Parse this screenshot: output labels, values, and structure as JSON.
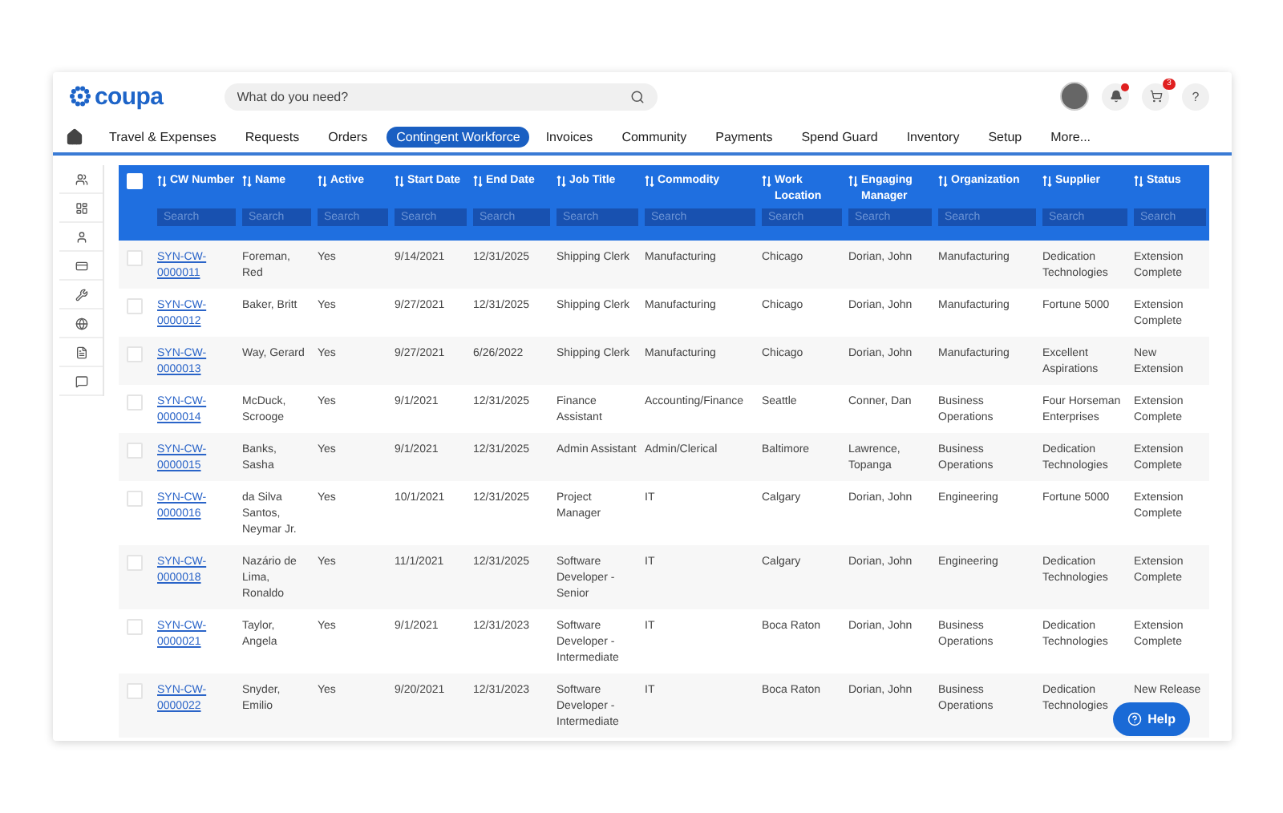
{
  "header": {
    "logo": "coupa",
    "search": {
      "placeholder": "What do you need?"
    },
    "notifications": {
      "unread": true
    },
    "cart": {
      "count": "3"
    },
    "help": "?"
  },
  "nav": [
    {
      "label": "Travel & Expenses",
      "selected": false
    },
    {
      "label": "Requests",
      "selected": false
    },
    {
      "label": "Orders",
      "selected": false
    },
    {
      "label": "Contingent Workforce",
      "selected": true
    },
    {
      "label": "Invoices",
      "selected": false
    },
    {
      "label": "Community",
      "selected": false
    },
    {
      "label": "Payments",
      "selected": false
    },
    {
      "label": "Spend Guard",
      "selected": false
    },
    {
      "label": "Inventory",
      "selected": false
    },
    {
      "label": "Setup",
      "selected": false
    },
    {
      "label": "More...",
      "selected": false
    }
  ],
  "sidebar": [
    {
      "kind": "people"
    },
    {
      "kind": "dashboard"
    },
    {
      "kind": "person"
    },
    {
      "kind": "card"
    },
    {
      "kind": "wrench"
    },
    {
      "kind": "globe"
    },
    {
      "kind": "document"
    },
    {
      "kind": "chat"
    }
  ],
  "table": {
    "select_all": {
      "checked": false
    },
    "columns": [
      {
        "label": "CW Number",
        "placeholder": "Search"
      },
      {
        "label": "Name",
        "placeholder": "Search"
      },
      {
        "label": "Active",
        "placeholder": "Search"
      },
      {
        "label": "Start Date",
        "placeholder": "Search"
      },
      {
        "label": "End Date",
        "placeholder": "Search"
      },
      {
        "label": "Job Title",
        "placeholder": "Search"
      },
      {
        "label": "Commodity",
        "placeholder": "Search"
      },
      {
        "label": "Work Location",
        "placeholder": "Search"
      },
      {
        "label": "Engaging Manager",
        "placeholder": "Search"
      },
      {
        "label": "Organization",
        "placeholder": "Search"
      },
      {
        "label": "Supplier",
        "placeholder": "Search"
      },
      {
        "label": "Status",
        "placeholder": "Search"
      }
    ],
    "rows": [
      {
        "checked": false,
        "cells": [
          "SYN-CW-0000011",
          "Foreman, Red",
          "Yes",
          "9/14/2021",
          "12/31/2025",
          "Shipping Clerk",
          "Manufacturing",
          "Chicago",
          "Dorian, John",
          "Manufacturing",
          "Dedication Technologies",
          "Extension Complete"
        ]
      },
      {
        "checked": false,
        "cells": [
          "SYN-CW-0000012",
          "Baker, Britt",
          "Yes",
          "9/27/2021",
          "12/31/2025",
          "Shipping Clerk",
          "Manufacturing",
          "Chicago",
          "Dorian, John",
          "Manufacturing",
          "Fortune 5000",
          "Extension Complete"
        ]
      },
      {
        "checked": false,
        "cells": [
          "SYN-CW-0000013",
          "Way, Gerard",
          "Yes",
          "9/27/2021",
          "6/26/2022",
          "Shipping Clerk",
          "Manufacturing",
          "Chicago",
          "Dorian, John",
          "Manufacturing",
          "Excellent Aspirations",
          "New Extension"
        ]
      },
      {
        "checked": false,
        "cells": [
          "SYN-CW-0000014",
          "McDuck, Scrooge",
          "Yes",
          "9/1/2021",
          "12/31/2025",
          "Finance Assistant",
          "Accounting/Finance",
          "Seattle",
          "Conner, Dan",
          "Business Operations",
          "Four Horseman Enterprises",
          "Extension Complete"
        ]
      },
      {
        "checked": false,
        "cells": [
          "SYN-CW-0000015",
          "Banks, Sasha",
          "Yes",
          "9/1/2021",
          "12/31/2025",
          "Admin Assistant",
          "Admin/Clerical",
          "Baltimore",
          "Lawrence, Topanga",
          "Business Operations",
          "Dedication Technologies",
          "Extension Complete"
        ]
      },
      {
        "checked": false,
        "cells": [
          "SYN-CW-0000016",
          "da Silva Santos, Neymar Jr.",
          "Yes",
          "10/1/2021",
          "12/31/2025",
          "Project Manager",
          "IT",
          "Calgary",
          "Dorian, John",
          "Engineering",
          "Fortune 5000",
          "Extension Complete"
        ]
      },
      {
        "checked": false,
        "cells": [
          "SYN-CW-0000018",
          "Nazário de Lima, Ronaldo",
          "Yes",
          "11/1/2021",
          "12/31/2025",
          "Software Developer - Senior",
          "IT",
          "Calgary",
          "Dorian, John",
          "Engineering",
          "Dedication Technologies",
          "Extension Complete"
        ]
      },
      {
        "checked": false,
        "cells": [
          "SYN-CW-0000021",
          "Taylor, Angela",
          "Yes",
          "9/1/2021",
          "12/31/2023",
          "Software Developer - Intermediate",
          "IT",
          "Boca Raton",
          "Dorian, John",
          "Business Operations",
          "Dedication Technologies",
          "Extension Complete"
        ]
      },
      {
        "checked": false,
        "cells": [
          "SYN-CW-0000022",
          "Snyder, Emilio",
          "Yes",
          "9/20/2021",
          "12/31/2023",
          "Software Developer - Intermediate",
          "IT",
          "Boca Raton",
          "Dorian, John",
          "Business Operations",
          "Dedication Technologies",
          "New Release"
        ]
      }
    ]
  },
  "help_button": "Help"
}
